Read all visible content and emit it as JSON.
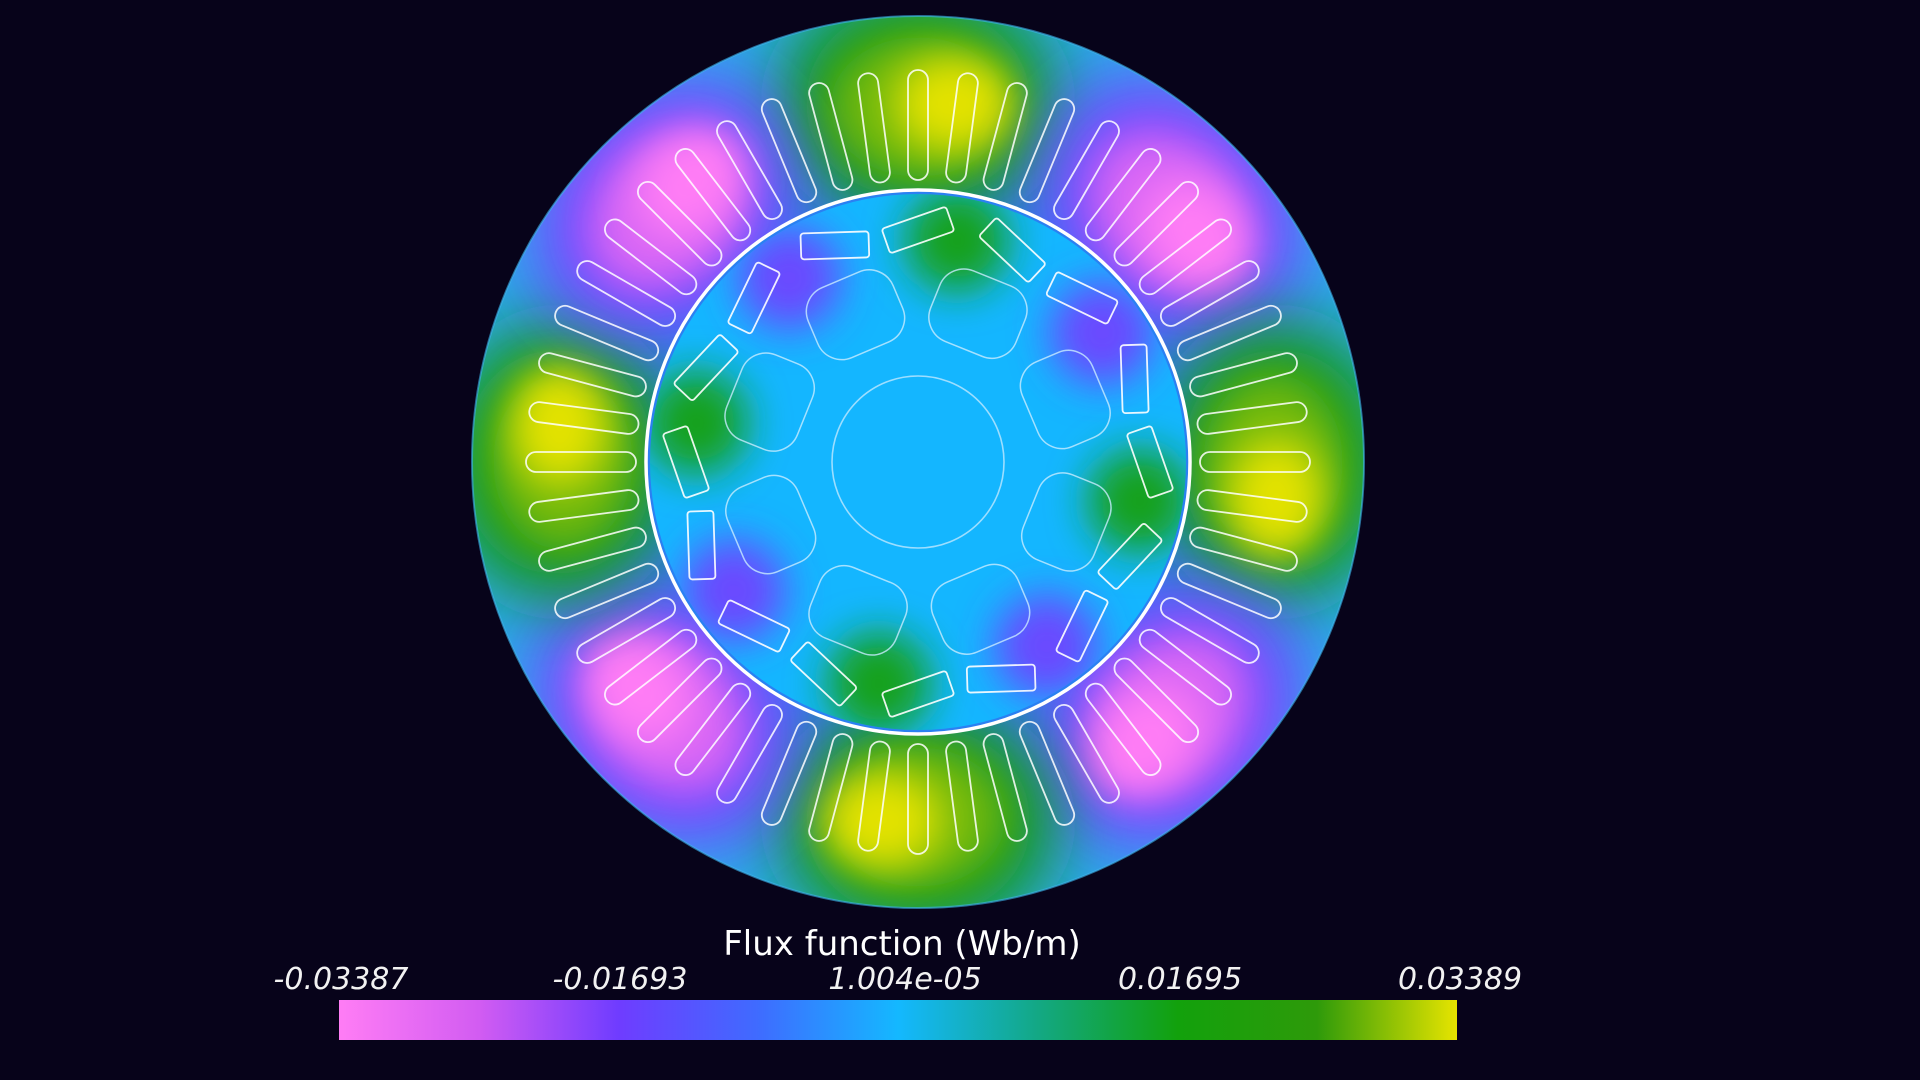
{
  "colorbar": {
    "title": "Flux function (Wb/m)",
    "tick_labels": [
      "-0.03387",
      "-0.01693",
      "1.004e-05",
      "0.01695",
      "0.03389"
    ],
    "range": [
      -0.03387,
      0.03389
    ],
    "colormap": [
      {
        "value": -0.03387,
        "color": "#ff7df5"
      },
      {
        "value": -0.0254,
        "color": "#d25cf2"
      },
      {
        "value": -0.01693,
        "color": "#6f3cff"
      },
      {
        "value": -0.0085,
        "color": "#3f6bff"
      },
      {
        "value": 1e-05,
        "color": "#14b8ff"
      },
      {
        "value": 0.0085,
        "color": "#13a884"
      },
      {
        "value": 0.01695,
        "color": "#12a10c"
      },
      {
        "value": 0.0254,
        "color": "#2e9a0a"
      },
      {
        "value": 0.03389,
        "color": "#e6e400"
      }
    ]
  },
  "colors": {
    "background": "#07031a",
    "stator_base": "#27a8ee",
    "rotor_fill": "#14b6ff",
    "outline": "#ffffff"
  }
}
